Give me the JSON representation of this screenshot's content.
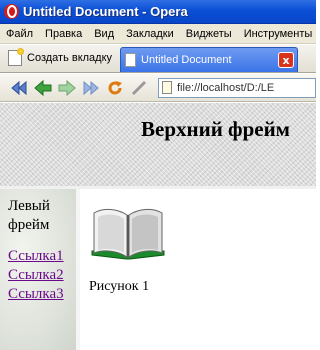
{
  "window": {
    "title": "Untitled Document - Opera"
  },
  "menu": [
    "Файл",
    "Правка",
    "Вид",
    "Закладки",
    "Виджеты",
    "Инструменты"
  ],
  "tabs": {
    "new_tab_label": "Создать вкладку",
    "active_tab_title": "Untitled Document",
    "close_glyph": "x"
  },
  "address_bar": {
    "url": "file://localhost/D:/LE"
  },
  "top_frame": {
    "heading": "Верхний фрейм"
  },
  "left_frame": {
    "title": "Левый фрейм",
    "links": [
      "Ссылка1",
      "Ссылка2",
      "Ссылка3"
    ]
  },
  "main_frame": {
    "caption": "Рисунок 1"
  },
  "colors": {
    "titlebar": "#0a4fd6",
    "tab_active": "#3a74e8",
    "link_visited": "#6a0a8a",
    "close_button": "#d9331c"
  }
}
